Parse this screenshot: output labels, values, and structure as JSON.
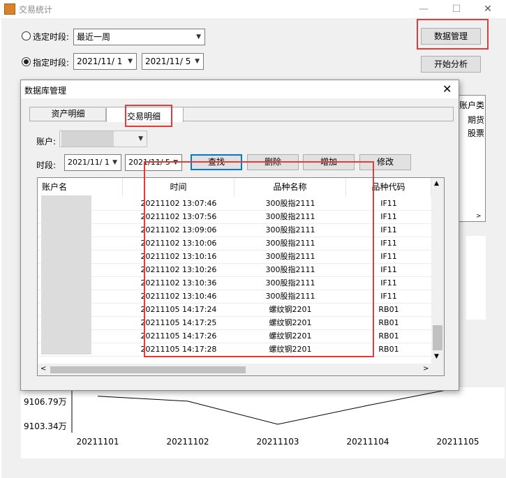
{
  "window": {
    "title": "交易统计",
    "minimize": "—",
    "maximize": "☐",
    "close": "✕"
  },
  "controls": {
    "radio_period_label": "选定时段:",
    "period_value": "最近一周",
    "radio_custom_label": "指定时段:",
    "start_date": "2021/11/  1",
    "end_date": "2021/11/  5",
    "db_manage_label": "数据管理",
    "analyze_label": "开始分析"
  },
  "right_panel": {
    "header": "账户类",
    "items": [
      "期货",
      "股票"
    ]
  },
  "chart_data": {
    "type": "line",
    "categories": [
      "20211101",
      "20211102",
      "20211103",
      "20211104",
      "20211105"
    ],
    "y_tick_labels": [
      "9106.79万",
      "9103.34万"
    ],
    "values_wan": [
      9107.3,
      9106.6,
      9103.34,
      9106.0,
      9108.5
    ]
  },
  "dialog": {
    "title": "数据库管理",
    "close": "✕",
    "tabs": [
      {
        "label": "资产明细"
      },
      {
        "label": "交易明细"
      }
    ],
    "account_label": "账户:",
    "period_label": "时段:",
    "start_date": "2021/11/  1",
    "end_date": "2021/11/  5",
    "buttons": {
      "query": "查找",
      "delete": "删除",
      "add": "增加",
      "edit": "修改"
    },
    "columns": [
      "账户名",
      "时间",
      "品种名称",
      "品种代码"
    ],
    "rows": [
      {
        "time": "20211102 13:07:46",
        "name": "300股指2111",
        "code": "IF11"
      },
      {
        "time": "20211102 13:07:56",
        "name": "300股指2111",
        "code": "IF11"
      },
      {
        "time": "20211102 13:09:06",
        "name": "300股指2111",
        "code": "IF11"
      },
      {
        "time": "20211102 13:10:06",
        "name": "300股指2111",
        "code": "IF11"
      },
      {
        "time": "20211102 13:10:16",
        "name": "300股指2111",
        "code": "IF11"
      },
      {
        "time": "20211102 13:10:26",
        "name": "300股指2111",
        "code": "IF11"
      },
      {
        "time": "20211102 13:10:36",
        "name": "300股指2111",
        "code": "IF11"
      },
      {
        "time": "20211102 13:10:46",
        "name": "300股指2111",
        "code": "IF11"
      },
      {
        "time": "20211105 14:17:24",
        "name": "螺纹钢2201",
        "code": "RB01"
      },
      {
        "time": "20211105 14:17:25",
        "name": "螺纹钢2201",
        "code": "RB01"
      },
      {
        "time": "20211105 14:17:26",
        "name": "螺纹钢2201",
        "code": "RB01"
      },
      {
        "time": "20211105 14:17:28",
        "name": "螺纹钢2201",
        "code": "RB01"
      }
    ]
  },
  "colors": {
    "highlight": "#e03c3c",
    "selected_button": "#0078d7"
  }
}
